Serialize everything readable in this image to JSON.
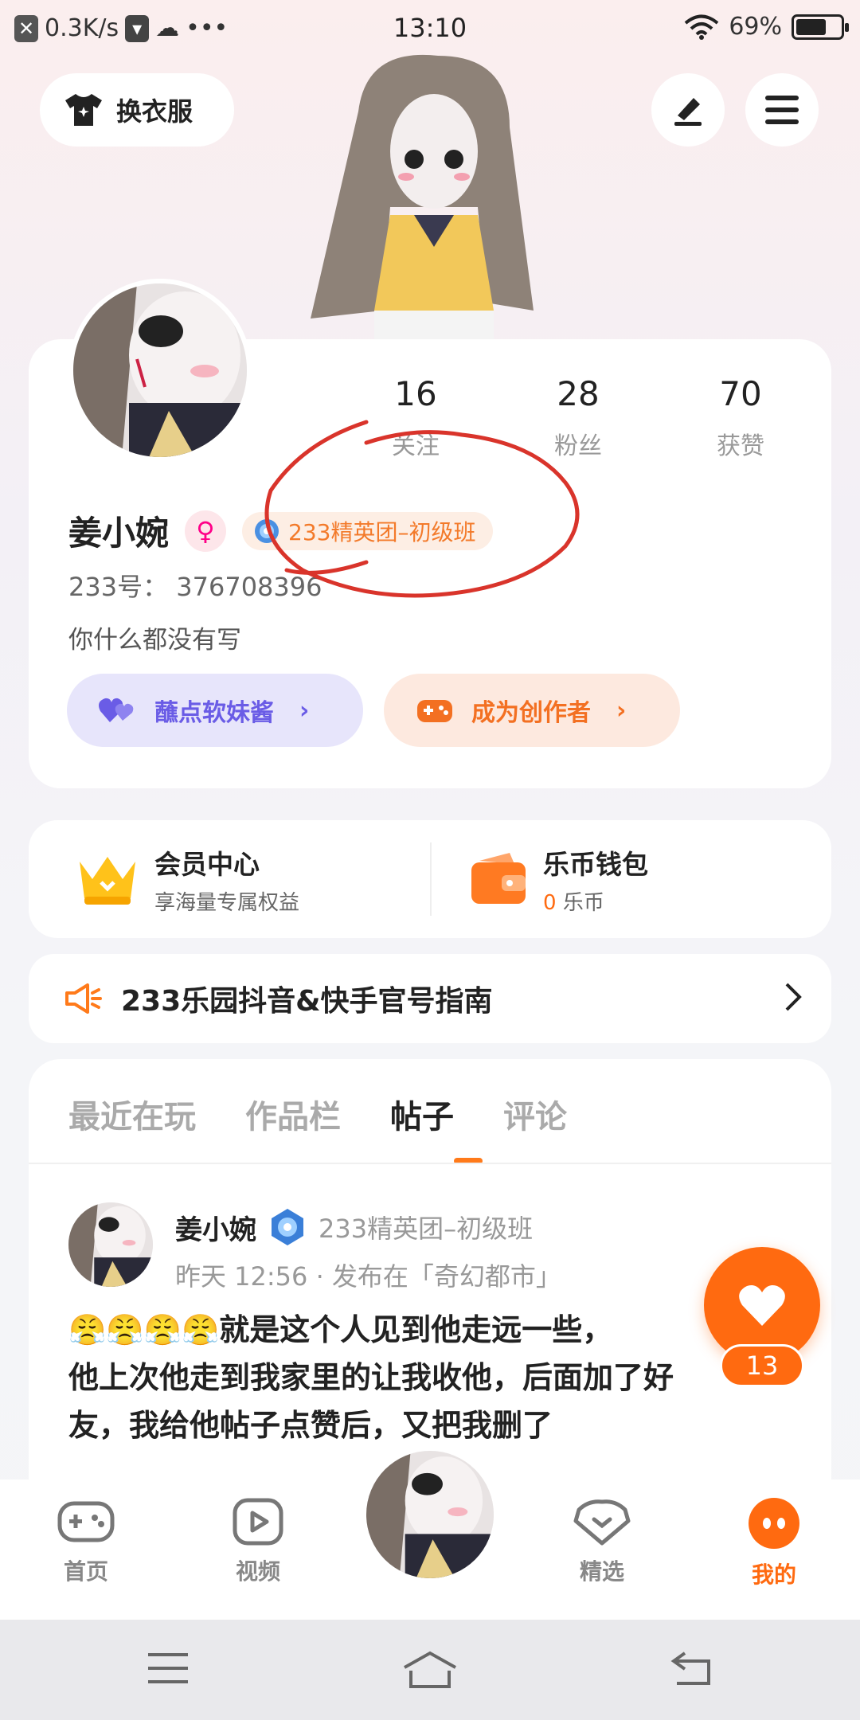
{
  "status_bar": {
    "net_speed": "0.3K/s",
    "time": "13:10",
    "battery": "69%",
    "battery_level": 0.69
  },
  "header": {
    "outfit_label": "换衣服",
    "edit_icon": "pen-icon",
    "menu_icon": "menu-icon"
  },
  "profile": {
    "stats": [
      {
        "value": "16",
        "label": "关注"
      },
      {
        "value": "28",
        "label": "粉丝"
      },
      {
        "value": "70",
        "label": "获赞"
      }
    ],
    "name": "姜小婉",
    "title_badge": "233精英团–初级班",
    "uid": "233号： 376708396",
    "bio": "你什么都没有写",
    "buttons": [
      {
        "label": "蘸点软妹酱",
        "icon": "hearts-icon"
      },
      {
        "label": "成为创作者",
        "icon": "gamepad-plus-icon"
      }
    ]
  },
  "vip": {
    "member_title": "会员中心",
    "member_sub": "享海量专属权益",
    "wallet_title": "乐币钱包",
    "wallet_amount": "0",
    "wallet_unit": "乐币"
  },
  "notice": {
    "text": "233乐园抖音&快手官号指南"
  },
  "feed": {
    "tabs": [
      "最近在玩",
      "作品栏",
      "帖子",
      "评论"
    ],
    "active_tab": 2,
    "post": {
      "author": "姜小婉",
      "badge": "233精英团–初级班",
      "time": "昨天 12:56",
      "location": "· 发布在「奇幻都市」",
      "line1": "😤😤😤😤就是这个人见到他走远一些，",
      "line2": "他上次他走到我家里的让我收他，后面加了好",
      "line3": "友，我给他帖子点赞后，又把我删了"
    },
    "like_count": "13"
  },
  "bottom_nav": [
    {
      "label": "首页",
      "icon": "gamepad-icon"
    },
    {
      "label": "视频",
      "icon": "play-icon"
    },
    {
      "label": "精选",
      "icon": "heart-badge-icon"
    },
    {
      "label": "我的",
      "icon": "face-icon",
      "active": true
    }
  ],
  "colors": {
    "accent": "#ff6a10",
    "purple": "#6a5ce6",
    "annotation_red": "#d9342b"
  }
}
